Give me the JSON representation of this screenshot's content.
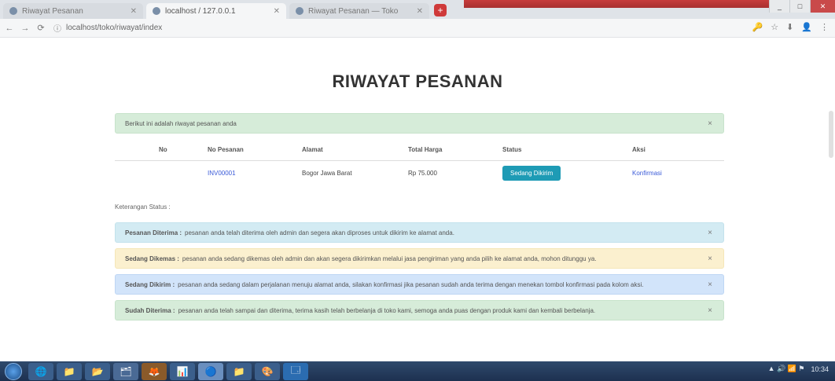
{
  "browser": {
    "tabs": [
      {
        "label": "Riwayat Pesanan",
        "active": false
      },
      {
        "label": "localhost / 127.0.0.1",
        "active": true
      },
      {
        "label": "Riwayat Pesanan — Toko",
        "active": false
      }
    ],
    "new_tab_label": "+",
    "window_buttons": {
      "minimize": "_",
      "maximize": "□",
      "close": "✕"
    },
    "url": "localhost/toko/riwayat/index",
    "nav": {
      "back": "←",
      "forward": "→",
      "reload": "⟳",
      "info": "ⓘ"
    },
    "toolbar_icons": [
      "🔑",
      "☆",
      "⬇",
      "👤",
      "⋮"
    ]
  },
  "page": {
    "title": "RIWAYAT PESANAN",
    "success_alert": "Berikut ini adalah riwayat pesanan anda",
    "dismiss": "×",
    "table": {
      "headers": [
        "No",
        "No Pesanan",
        "Alamat",
        "Total Harga",
        "Status",
        "Aksi"
      ],
      "rows": [
        {
          "no": "",
          "order_no": "INV00001",
          "address": "Bogor Jawa Barat",
          "total": "Rp 75.000",
          "status": "Sedang Dikirim",
          "action": "Konfirmasi"
        }
      ]
    },
    "notes_label": "Keterangan Status :",
    "notes": [
      {
        "kind": "info",
        "title": "Pesanan Diterima :",
        "text": "pesanan anda telah diterima oleh admin dan segera akan diproses untuk dikirim ke alamat anda."
      },
      {
        "kind": "warning",
        "title": "Sedang Dikemas :",
        "text": "pesanan anda sedang dikemas oleh admin dan akan segera dikirimkan melalui jasa pengiriman yang anda pilih ke alamat anda, mohon ditunggu ya."
      },
      {
        "kind": "primary",
        "title": "Sedang Dikirim :",
        "text": "pesanan anda sedang dalam perjalanan menuju alamat anda, silakan konfirmasi jika pesanan sudah anda terima dengan menekan tombol konfirmasi pada kolom aksi."
      },
      {
        "kind": "success",
        "title": "Sudah Diterima :",
        "text": "pesanan anda telah sampai dan diterima, terima kasih telah berbelanja di toko kami, semoga anda puas dengan produk kami dan kembali berbelanja."
      }
    ]
  },
  "taskbar": {
    "apps": [
      "🌐",
      "📁",
      "📂",
      "🗂",
      "🦊",
      "📊",
      "🔵",
      "📁",
      "🎨",
      "🗔"
    ],
    "tray_text": "▲ 🔊 📶 ⚑",
    "clock": "10:34"
  },
  "colors": {
    "status_button": "#1e9bb5",
    "link": "#3a5ad8",
    "taskbar": "#2f4a6c"
  }
}
